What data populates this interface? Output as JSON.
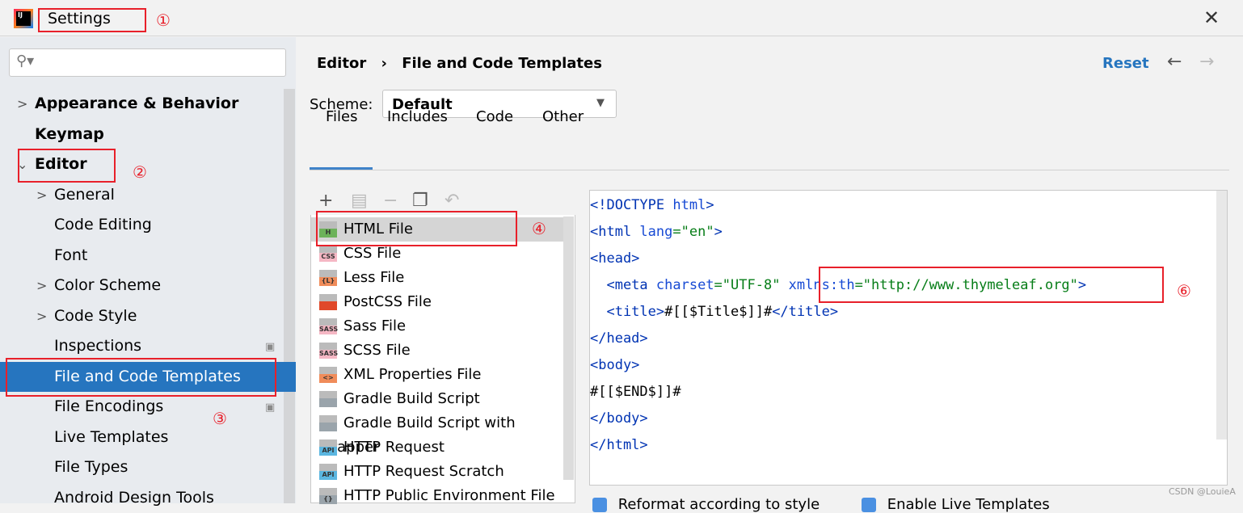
{
  "window": {
    "title": "Settings",
    "close_icon": "close-icon",
    "logo": "IJ"
  },
  "annotations": [
    "①",
    "②",
    "③",
    "④",
    "⑥"
  ],
  "sidebar": {
    "search_placeholder": "",
    "items": [
      {
        "label": "Appearance & Behavior",
        "bold": true,
        "chevron": ">"
      },
      {
        "label": "Keymap",
        "bold": true
      },
      {
        "label": "Editor",
        "bold": true,
        "chevron": "⌄"
      },
      {
        "label": "General",
        "chevron": ">"
      },
      {
        "label": "Code Editing"
      },
      {
        "label": "Font"
      },
      {
        "label": "Color Scheme",
        "chevron": ">"
      },
      {
        "label": "Code Style",
        "chevron": ">"
      },
      {
        "label": "Inspections"
      },
      {
        "label": "File and Code Templates",
        "selected": true
      },
      {
        "label": "File Encodings"
      },
      {
        "label": "Live Templates"
      },
      {
        "label": "File Types"
      },
      {
        "label": "Android Design Tools"
      }
    ]
  },
  "header": {
    "breadcrumb": [
      "Editor",
      "File and Code Templates"
    ],
    "separator": "›",
    "reset": "Reset",
    "back": "←",
    "forward": "→"
  },
  "scheme": {
    "label": "Scheme:",
    "value": "Default"
  },
  "tabs": [
    {
      "label": "Files",
      "active": true
    },
    {
      "label": "Includes"
    },
    {
      "label": "Code"
    },
    {
      "label": "Other"
    }
  ],
  "toolbar": [
    "add-icon",
    "copy-template-icon",
    "remove-icon",
    "duplicate-icon",
    "reset-icon"
  ],
  "templates": [
    {
      "label": "HTML File",
      "badge": "H",
      "color": "#6db25a",
      "selected": true
    },
    {
      "label": "CSS File",
      "badge": "CSS",
      "color": "#f5b7c4"
    },
    {
      "label": "Less File",
      "badge": "{L}",
      "color": "#f08c5a"
    },
    {
      "label": "PostCSS File",
      "badge": "",
      "color": "#e0482a"
    },
    {
      "label": "Sass File",
      "badge": "SASS",
      "color": "#f5b7c4"
    },
    {
      "label": "SCSS File",
      "badge": "SASS",
      "color": "#f5b7c4"
    },
    {
      "label": "XML Properties File",
      "badge": "<>",
      "color": "#f08c5a"
    },
    {
      "label": "Gradle Build Script",
      "badge": "",
      "color": "#9aa4ab"
    },
    {
      "label": "Gradle Build Script with wrapper",
      "badge": "",
      "color": "#9aa4ab"
    },
    {
      "label": "HTTP Request",
      "badge": "API",
      "color": "#5bb6e0"
    },
    {
      "label": "HTTP Request Scratch",
      "badge": "API",
      "color": "#5bb6e0"
    },
    {
      "label": "HTTP Public Environment File",
      "badge": "{}",
      "color": "#9aa4ab"
    }
  ],
  "code": [
    [
      [
        "t",
        "<!DOCTYPE "
      ],
      [
        "a",
        "html"
      ],
      [
        "t",
        ">"
      ]
    ],
    [
      [
        "t",
        "<html "
      ],
      [
        "a",
        "lang"
      ],
      [
        "s",
        "=\"en\""
      ],
      [
        "t",
        ">"
      ]
    ],
    [
      [
        "t",
        "<head>"
      ]
    ],
    [
      [
        "t",
        "  <meta "
      ],
      [
        "a",
        "charset"
      ],
      [
        "s",
        "=\"UTF-8\" "
      ],
      [
        "a",
        "xmlns:th"
      ],
      [
        "s",
        "=\"http://www.thymeleaf.org\""
      ],
      [
        "t",
        ">"
      ]
    ],
    [
      [
        "t",
        "  <title>"
      ],
      [
        "x",
        "#[[$Title$]]#"
      ],
      [
        "t",
        "</title>"
      ]
    ],
    [
      [
        "t",
        "</head>"
      ]
    ],
    [
      [
        "t",
        "<body>"
      ]
    ],
    [
      [
        "x",
        "#[[$END$]]#"
      ]
    ],
    [
      [
        "t",
        "</body>"
      ]
    ],
    [
      [
        "t",
        "</html>"
      ]
    ]
  ],
  "checkboxes": [
    {
      "label": "Reformat according to style",
      "checked": true
    },
    {
      "label": "Enable Live Templates",
      "checked": true
    }
  ],
  "watermark": "CSDN @LouieA"
}
